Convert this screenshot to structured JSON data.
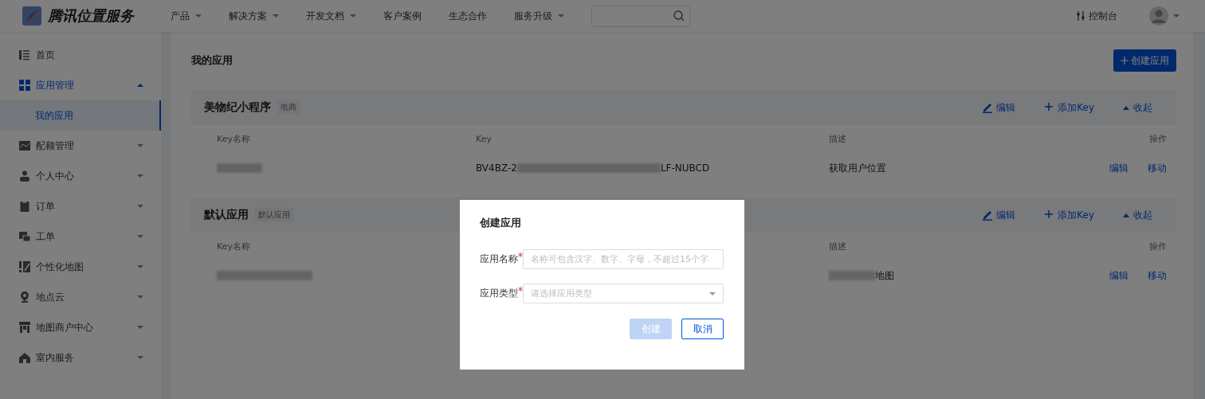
{
  "header": {
    "logo": "腾讯位置服务",
    "nav": [
      {
        "label": "产品",
        "has_menu": true
      },
      {
        "label": "解决方案",
        "has_menu": true
      },
      {
        "label": "开发文档",
        "has_menu": true
      },
      {
        "label": "客户案例",
        "has_menu": false
      },
      {
        "label": "生态合作",
        "has_menu": false
      },
      {
        "label": "服务升级",
        "has_menu": true
      }
    ],
    "console": "控制台"
  },
  "sidebar": {
    "items": [
      {
        "label": "首页",
        "kind": "link",
        "selected": false
      },
      {
        "label": "应用管理",
        "kind": "group",
        "selected": true,
        "expanded": true,
        "children": [
          {
            "label": "我的应用",
            "selected": true
          }
        ]
      },
      {
        "label": "配额管理",
        "kind": "group",
        "selected": false,
        "expanded": false
      },
      {
        "label": "个人中心",
        "kind": "group",
        "selected": false,
        "expanded": false
      },
      {
        "label": "订单",
        "kind": "group",
        "selected": false,
        "expanded": false
      },
      {
        "label": "工单",
        "kind": "group",
        "selected": false,
        "expanded": false
      },
      {
        "label": "个性化地图",
        "kind": "group",
        "selected": false,
        "expanded": false
      },
      {
        "label": "地点云",
        "kind": "group",
        "selected": false,
        "expanded": false
      },
      {
        "label": "地图商户中心",
        "kind": "group",
        "selected": false,
        "expanded": false
      },
      {
        "label": "室内服务",
        "kind": "group",
        "selected": false,
        "expanded": false
      }
    ]
  },
  "page": {
    "title": "我的应用",
    "create_button": "创建应用",
    "apps": [
      {
        "name": "美物纪小程序",
        "tag": "电商",
        "actions": [
          "编辑",
          "添加Key",
          "收起"
        ],
        "columns": {
          "key_name": "Key名称",
          "key": "Key",
          "description": "描述",
          "operations": "操作"
        },
        "rows": [
          {
            "key_prefix": "BV4BZ-2",
            "key_suffix": "LF-NUBCD",
            "description": "获取用户位置",
            "actions": [
              "编辑",
              "移动"
            ]
          }
        ]
      },
      {
        "name": "默认应用",
        "tag": "默认应用",
        "actions": [
          "编辑",
          "添加Key",
          "收起"
        ],
        "columns": {
          "key_name": "Key名称",
          "description": "描述",
          "operations": "操作"
        },
        "rows": [
          {
            "description": "地图",
            "actions": [
              "编辑",
              "移动"
            ]
          }
        ]
      }
    ]
  },
  "dialog": {
    "title": "创建应用",
    "fields": [
      {
        "label": "应用名称",
        "required": true,
        "kind": "input",
        "placeholder": "名称可包含汉字、数字、字母，不超过15个字"
      },
      {
        "label": "应用类型",
        "required": true,
        "kind": "select",
        "placeholder": "请选择应用类型"
      }
    ],
    "buttons": [
      {
        "label": "创建",
        "kind": "primary",
        "disabled": true
      },
      {
        "label": "取消",
        "kind": "default",
        "disabled": false
      }
    ]
  }
}
